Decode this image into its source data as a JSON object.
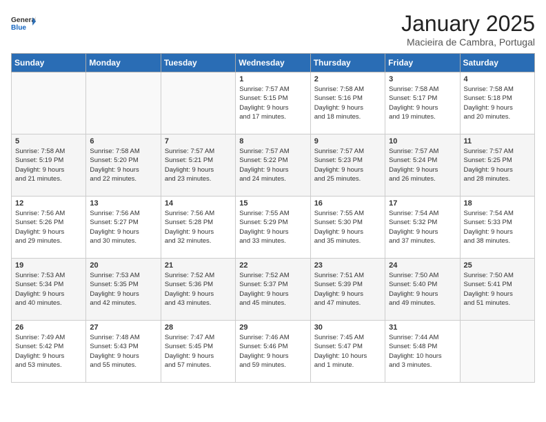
{
  "header": {
    "logo_general": "General",
    "logo_blue": "Blue",
    "title": "January 2025",
    "subtitle": "Macieira de Cambra, Portugal"
  },
  "weekdays": [
    "Sunday",
    "Monday",
    "Tuesday",
    "Wednesday",
    "Thursday",
    "Friday",
    "Saturday"
  ],
  "weeks": [
    [
      {
        "day": "",
        "info": ""
      },
      {
        "day": "",
        "info": ""
      },
      {
        "day": "",
        "info": ""
      },
      {
        "day": "1",
        "info": "Sunrise: 7:57 AM\nSunset: 5:15 PM\nDaylight: 9 hours\nand 17 minutes."
      },
      {
        "day": "2",
        "info": "Sunrise: 7:58 AM\nSunset: 5:16 PM\nDaylight: 9 hours\nand 18 minutes."
      },
      {
        "day": "3",
        "info": "Sunrise: 7:58 AM\nSunset: 5:17 PM\nDaylight: 9 hours\nand 19 minutes."
      },
      {
        "day": "4",
        "info": "Sunrise: 7:58 AM\nSunset: 5:18 PM\nDaylight: 9 hours\nand 20 minutes."
      }
    ],
    [
      {
        "day": "5",
        "info": "Sunrise: 7:58 AM\nSunset: 5:19 PM\nDaylight: 9 hours\nand 21 minutes."
      },
      {
        "day": "6",
        "info": "Sunrise: 7:58 AM\nSunset: 5:20 PM\nDaylight: 9 hours\nand 22 minutes."
      },
      {
        "day": "7",
        "info": "Sunrise: 7:57 AM\nSunset: 5:21 PM\nDaylight: 9 hours\nand 23 minutes."
      },
      {
        "day": "8",
        "info": "Sunrise: 7:57 AM\nSunset: 5:22 PM\nDaylight: 9 hours\nand 24 minutes."
      },
      {
        "day": "9",
        "info": "Sunrise: 7:57 AM\nSunset: 5:23 PM\nDaylight: 9 hours\nand 25 minutes."
      },
      {
        "day": "10",
        "info": "Sunrise: 7:57 AM\nSunset: 5:24 PM\nDaylight: 9 hours\nand 26 minutes."
      },
      {
        "day": "11",
        "info": "Sunrise: 7:57 AM\nSunset: 5:25 PM\nDaylight: 9 hours\nand 28 minutes."
      }
    ],
    [
      {
        "day": "12",
        "info": "Sunrise: 7:56 AM\nSunset: 5:26 PM\nDaylight: 9 hours\nand 29 minutes."
      },
      {
        "day": "13",
        "info": "Sunrise: 7:56 AM\nSunset: 5:27 PM\nDaylight: 9 hours\nand 30 minutes."
      },
      {
        "day": "14",
        "info": "Sunrise: 7:56 AM\nSunset: 5:28 PM\nDaylight: 9 hours\nand 32 minutes."
      },
      {
        "day": "15",
        "info": "Sunrise: 7:55 AM\nSunset: 5:29 PM\nDaylight: 9 hours\nand 33 minutes."
      },
      {
        "day": "16",
        "info": "Sunrise: 7:55 AM\nSunset: 5:30 PM\nDaylight: 9 hours\nand 35 minutes."
      },
      {
        "day": "17",
        "info": "Sunrise: 7:54 AM\nSunset: 5:32 PM\nDaylight: 9 hours\nand 37 minutes."
      },
      {
        "day": "18",
        "info": "Sunrise: 7:54 AM\nSunset: 5:33 PM\nDaylight: 9 hours\nand 38 minutes."
      }
    ],
    [
      {
        "day": "19",
        "info": "Sunrise: 7:53 AM\nSunset: 5:34 PM\nDaylight: 9 hours\nand 40 minutes."
      },
      {
        "day": "20",
        "info": "Sunrise: 7:53 AM\nSunset: 5:35 PM\nDaylight: 9 hours\nand 42 minutes."
      },
      {
        "day": "21",
        "info": "Sunrise: 7:52 AM\nSunset: 5:36 PM\nDaylight: 9 hours\nand 43 minutes."
      },
      {
        "day": "22",
        "info": "Sunrise: 7:52 AM\nSunset: 5:37 PM\nDaylight: 9 hours\nand 45 minutes."
      },
      {
        "day": "23",
        "info": "Sunrise: 7:51 AM\nSunset: 5:39 PM\nDaylight: 9 hours\nand 47 minutes."
      },
      {
        "day": "24",
        "info": "Sunrise: 7:50 AM\nSunset: 5:40 PM\nDaylight: 9 hours\nand 49 minutes."
      },
      {
        "day": "25",
        "info": "Sunrise: 7:50 AM\nSunset: 5:41 PM\nDaylight: 9 hours\nand 51 minutes."
      }
    ],
    [
      {
        "day": "26",
        "info": "Sunrise: 7:49 AM\nSunset: 5:42 PM\nDaylight: 9 hours\nand 53 minutes."
      },
      {
        "day": "27",
        "info": "Sunrise: 7:48 AM\nSunset: 5:43 PM\nDaylight: 9 hours\nand 55 minutes."
      },
      {
        "day": "28",
        "info": "Sunrise: 7:47 AM\nSunset: 5:45 PM\nDaylight: 9 hours\nand 57 minutes."
      },
      {
        "day": "29",
        "info": "Sunrise: 7:46 AM\nSunset: 5:46 PM\nDaylight: 9 hours\nand 59 minutes."
      },
      {
        "day": "30",
        "info": "Sunrise: 7:45 AM\nSunset: 5:47 PM\nDaylight: 10 hours\nand 1 minute."
      },
      {
        "day": "31",
        "info": "Sunrise: 7:44 AM\nSunset: 5:48 PM\nDaylight: 10 hours\nand 3 minutes."
      },
      {
        "day": "",
        "info": ""
      }
    ]
  ]
}
